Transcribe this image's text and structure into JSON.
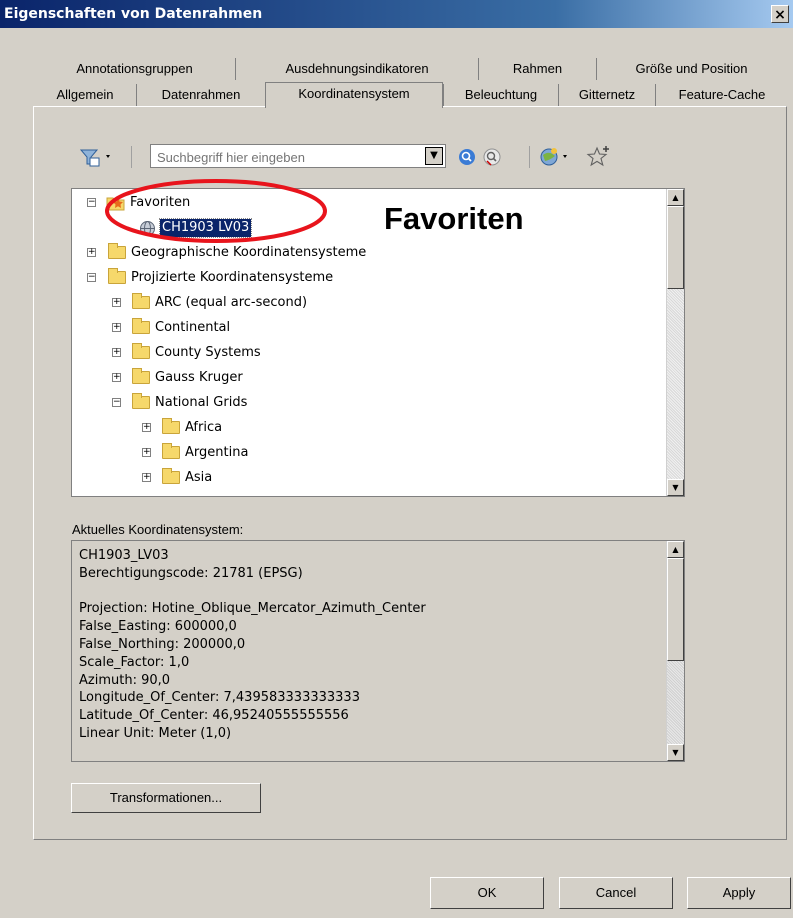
{
  "window": {
    "title": "Eigenschaften von Datenrahmen",
    "close_glyph": "×"
  },
  "tabs_row1": [
    "Annotationsgruppen",
    "Ausdehnungsindikatoren",
    "Rahmen",
    "Größe und Position"
  ],
  "tabs_row2": [
    "Allgemein",
    "Datenrahmen",
    "Koordinatensystem",
    "Beleuchtung",
    "Gitternetz",
    "Feature-Cache"
  ],
  "active_tab": "Koordinatensystem",
  "toolbar": {
    "search_placeholder": "Suchbegriff hier eingeben",
    "icons": [
      "filter-icon",
      "search-icon",
      "clear-search-icon",
      "globe-add-icon",
      "favorite-star-icon"
    ]
  },
  "tree": {
    "favorites": "Favoriten",
    "favorite_item": "CH1903 LV03",
    "geographic": "Geographische Koordinatensysteme",
    "projected": "Projizierte Koordinatensysteme",
    "projected_children": [
      "ARC (equal arc-second)",
      "Continental",
      "County Systems",
      "Gauss Kruger",
      "National Grids"
    ],
    "national_children": [
      "Africa",
      "Argentina",
      "Asia"
    ]
  },
  "annotation": {
    "text": "Favoriten",
    "circle_color": "#e8141c"
  },
  "current": {
    "label": "Aktuelles Koordinatensystem:",
    "lines": [
      "CH1903_LV03",
      "Berechtigungscode: 21781 (EPSG)",
      "",
      "Projection: Hotine_Oblique_Mercator_Azimuth_Center",
      "False_Easting: 600000,0",
      "False_Northing: 200000,0",
      "Scale_Factor: 1,0",
      "Azimuth: 90,0",
      "Longitude_Of_Center: 7,439583333333333",
      "Latitude_Of_Center: 46,95240555555556",
      "Linear Unit: Meter (1,0)"
    ]
  },
  "buttons": {
    "transform": "Transformationen...",
    "ok": "OK",
    "cancel": "Cancel",
    "apply": "Apply"
  }
}
